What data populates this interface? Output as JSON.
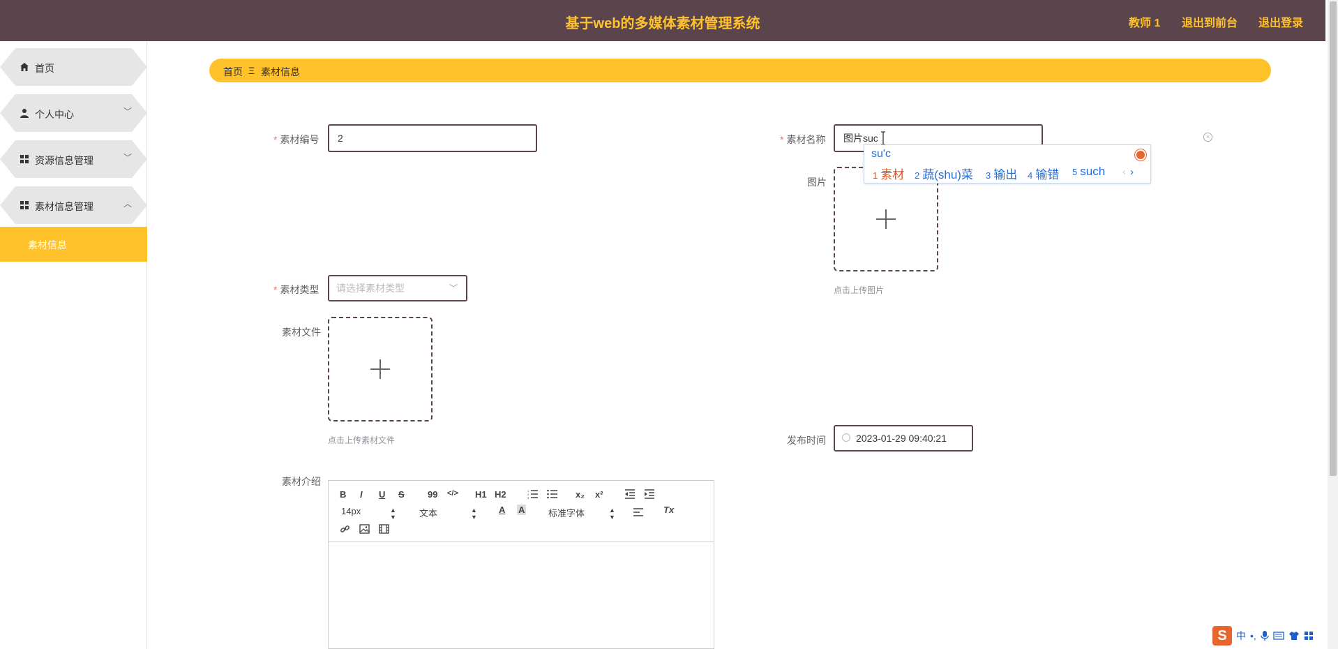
{
  "header": {
    "title": "基于web的多媒体素材管理系统",
    "user": "教师 1",
    "frontend": "退出到前台",
    "logout": "退出登录"
  },
  "sidebar": {
    "items": [
      {
        "label": "首页",
        "icon": "home-icon"
      },
      {
        "label": "个人中心",
        "icon": "user-icon"
      },
      {
        "label": "资源信息管理",
        "icon": "grid-icon"
      },
      {
        "label": "素材信息管理",
        "icon": "grid-icon"
      }
    ],
    "active_sub": "素材信息"
  },
  "breadcrumb": {
    "home": "首页",
    "sep": "Ξ",
    "current": "素材信息"
  },
  "form": {
    "code_label": "素材编号",
    "code_value": "2",
    "name_label": "素材名称",
    "name_value": "图片suc",
    "image_label": "图片",
    "image_hint": "点击上传图片",
    "type_label": "素材类型",
    "type_placeholder": "请选择素材类型",
    "file_label": "素材文件",
    "file_hint": "点击上传素材文件",
    "date_label": "发布时间",
    "date_value": "2023-01-29 09:40:21",
    "intro_label": "素材介绍"
  },
  "ime": {
    "composition": "su'c",
    "candidates": [
      {
        "n": "1",
        "text": "素材"
      },
      {
        "n": "2",
        "text": "蔬(shu)菜"
      },
      {
        "n": "3",
        "text": "输出"
      },
      {
        "n": "4",
        "text": "输错"
      },
      {
        "n": "5",
        "text": "such"
      }
    ]
  },
  "editor": {
    "font_size": "14px",
    "text_style": "文本",
    "font_family": "标准字体",
    "toolbar": {
      "bold": "B",
      "italic": "I",
      "underline": "U",
      "strike": "S",
      "quote": "99",
      "code": "</>",
      "h1": "H1",
      "h2": "H2",
      "sub": "x₂",
      "sup": "x²",
      "clear": "Tx"
    }
  },
  "tray": {
    "lang": "中",
    "punct": "•,"
  },
  "colors": {
    "accent": "#ffc22a",
    "header_bg": "#5c444c"
  }
}
